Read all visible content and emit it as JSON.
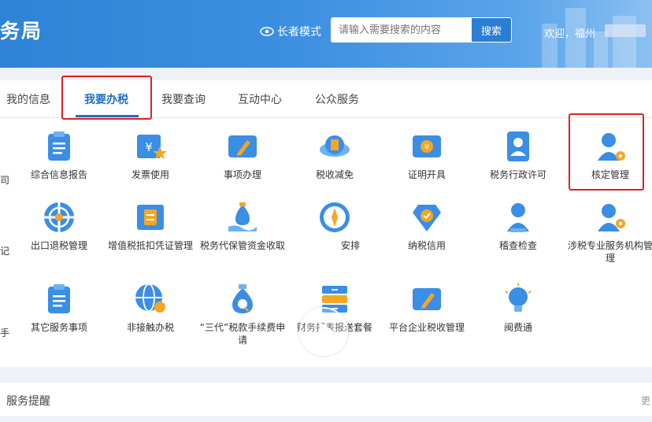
{
  "header": {
    "title": "务局",
    "elder_mode": "长者模式",
    "search_placeholder": "请输入需要搜索的内容",
    "search_button": "搜索",
    "welcome": "欢迎，福州"
  },
  "tabs": [
    "我的信息",
    "我要办税",
    "我要查询",
    "互动中心",
    "公众服务"
  ],
  "active_tab": "我要办税",
  "services": {
    "row1": [
      "综合信息报告",
      "发票使用",
      "事项办理",
      "税收减免",
      "证明开具",
      "税务行政许可",
      "核定管理"
    ],
    "row2": [
      "出口退税管理",
      "增值税抵扣凭证管理",
      "税务代保管资金收取",
      "安排",
      "纳税信用",
      "稽查检查",
      "涉税专业服务机构管理"
    ],
    "row3": [
      "其它服务事项",
      "非接触办税",
      "“三代”税款手续费申请",
      "财务报表报送套餐",
      "平台企业税收管理",
      "闽费通"
    ]
  },
  "edge_fragments": [
    "司",
    "记",
    "手"
  ],
  "reminder": {
    "title": "服务提醒",
    "more": "更"
  },
  "colors": {
    "primary": "#2f83d6",
    "highlight": "#e02020",
    "icon_blue": "#3a8ee6",
    "icon_orange": "#f5a623"
  }
}
